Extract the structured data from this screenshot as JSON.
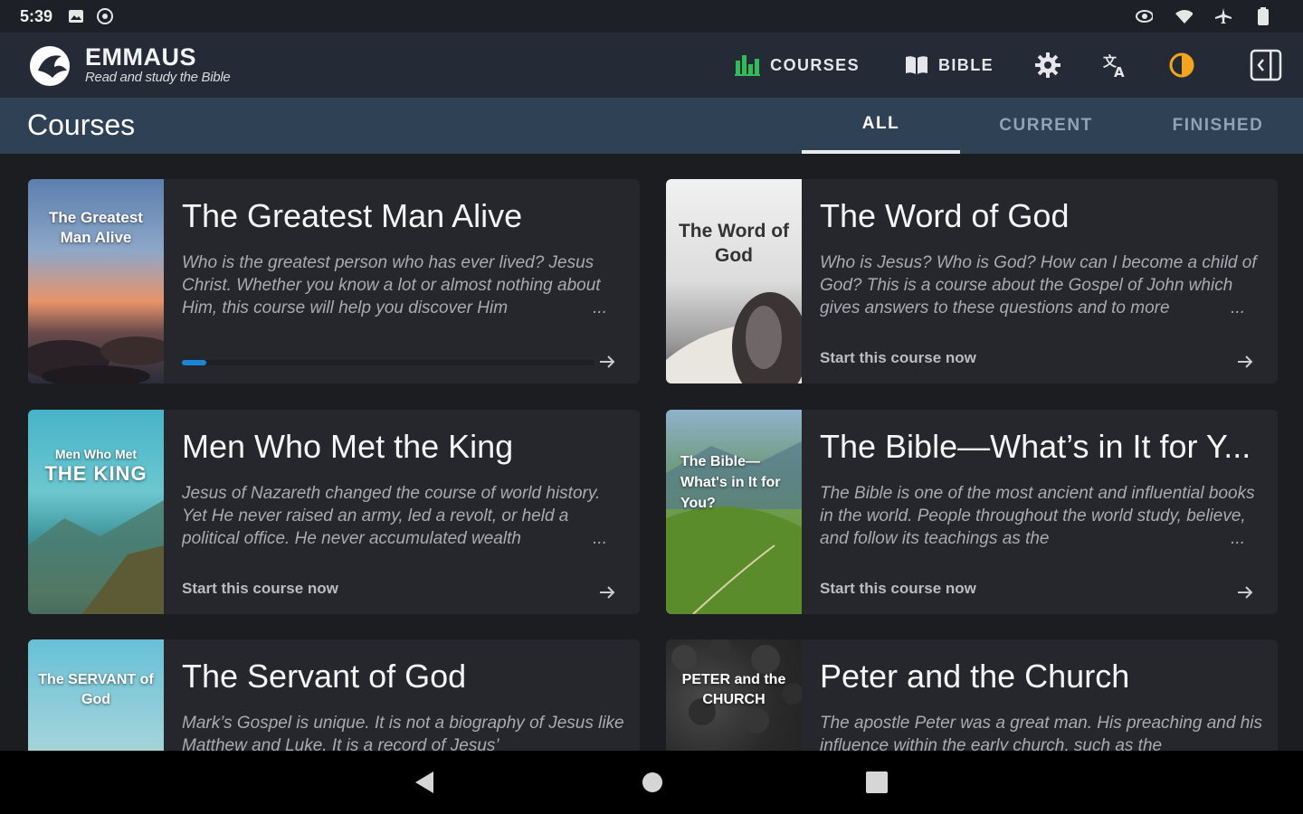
{
  "status_bar": {
    "time": "5:39"
  },
  "app": {
    "name": "EMMAUS",
    "tagline": "Read and study the Bible"
  },
  "nav": {
    "courses_label": "COURSES",
    "bible_label": "BIBLE"
  },
  "page": {
    "title": "Courses"
  },
  "tabs": [
    {
      "label": "ALL",
      "active": true
    },
    {
      "label": "CURRENT",
      "active": false
    },
    {
      "label": "FINISHED",
      "active": false
    }
  ],
  "courses": [
    {
      "cover_text": "The Greatest Man Alive",
      "title": "The Greatest Man Alive",
      "description": "Who is the greatest person who has ever lived? Jesus Christ. Whether you know a lot or almost nothing about Him, this course will help you discover Him",
      "footer": "",
      "progress": 0.06
    },
    {
      "cover_text": "The Word of God",
      "title": "The Word of God",
      "description": "Who is Jesus? Who is God? How can I become a child of God? This is a course about the Gospel of John which gives answers to these questions and to more",
      "footer": "Start this course now",
      "progress": null
    },
    {
      "cover_text": "Men Who Met THE KING",
      "title": "Men Who Met the King",
      "description": "Jesus of Nazareth changed the course of world history. Yet He never raised an army, led a revolt, or held a political office. He never accumulated wealth",
      "footer": "Start this course now",
      "progress": null
    },
    {
      "cover_text": "The Bible— What's in It for You?",
      "title": "The Bible—What’s in It for Y...",
      "description": "The Bible is one of the most ancient and influential books in the world. People throughout the world study, believe, and follow its teachings as the",
      "footer": "Start this course now",
      "progress": null
    },
    {
      "cover_text": "The SERVANT of God",
      "title": "The Servant of God",
      "description": "Mark’s Gospel is unique. It is not a biography of Jesus like Matthew and Luke. It is a record of Jesus’",
      "footer": "",
      "progress": null
    },
    {
      "cover_text": "PETER and the CHURCH",
      "title": "Peter and the Church",
      "description": "The apostle Peter was a great man. His preaching and his influence within the early church, such as the",
      "footer": "",
      "progress": null
    }
  ],
  "colors": {
    "accent": "#1b86d6",
    "appbar": "#252b36",
    "header": "#2f4155",
    "card": "#25272c",
    "courses_icon": "#2ebd58",
    "contrast_icon": "#f2a51d"
  }
}
